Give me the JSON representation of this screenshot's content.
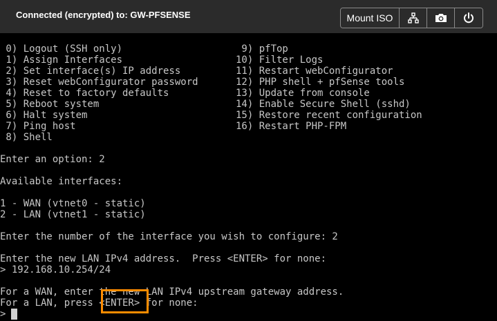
{
  "header": {
    "title": "Connected (encrypted) to: GW-PFSENSE",
    "mount_iso_label": "Mount ISO",
    "buttons": [
      {
        "icon": "network-icon"
      },
      {
        "icon": "camera-icon"
      },
      {
        "icon": "power-icon"
      }
    ]
  },
  "terminal": {
    "menu_left": [
      " 0) Logout (SSH only)",
      " 1) Assign Interfaces",
      " 2) Set interface(s) IP address",
      " 3) Reset webConfigurator password",
      " 4) Reset to factory defaults",
      " 5) Reboot system",
      " 6) Halt system",
      " 7) Ping host",
      " 8) Shell"
    ],
    "menu_right": [
      " 9) pfTop",
      "10) Filter Logs",
      "11) Restart webConfigurator",
      "12) PHP shell + pfSense tools",
      "13) Update from console",
      "14) Enable Secure Shell (sshd)",
      "15) Restore recent configuration",
      "16) Restart PHP-FPM"
    ],
    "enter_option": "Enter an option: 2",
    "available_interfaces": "Available interfaces:",
    "iface_1": "1 - WAN (vtnet0 - static)",
    "iface_2": "2 - LAN (vtnet1 - static)",
    "enter_number": "Enter the number of the interface you wish to configure: 2",
    "enter_ipv4": "Enter the new LAN IPv4 address.  Press <ENTER> for none:",
    "ipv4_value": "> 192.168.10.254/24",
    "for_wan": "For a WAN, enter the new LAN IPv4 upstream gateway address.",
    "for_lan": "For a LAN, press <ENTER> for none:",
    "prompt": ">"
  },
  "colors": {
    "highlight": "#ff8c00",
    "terminal_text": "#c7c7c7",
    "topbar_bg": "#2b2b2b"
  }
}
